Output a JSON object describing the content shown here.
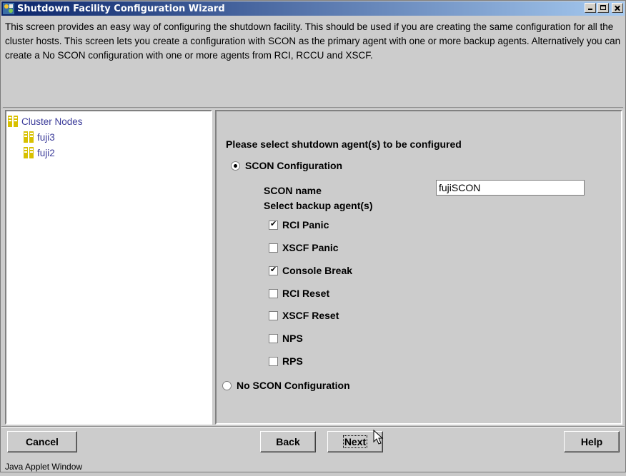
{
  "window": {
    "title": "Shutdown Facility Configuration Wizard"
  },
  "description": "This screen provides an easy way of configuring the shutdown facility. This should be used if you are creating the same configuration for all the cluster hosts. This screen lets you create a configuration with SCON as the primary agent with one or more backup agents. Alternatively you can create a No SCON configuration with one or more agents from RCI, RCCU and XSCF.",
  "tree": {
    "root_label": "Cluster Nodes",
    "nodes": [
      "fuji3",
      "fuji2"
    ]
  },
  "form": {
    "prompt": "Please select shutdown agent(s) to be configured",
    "scon_option_label": "SCON Configuration",
    "scon_option_selected": true,
    "scon_name_label": "SCON name",
    "scon_name_value": "fujiSCON",
    "backup_label": "Select backup agent(s)",
    "agents": [
      {
        "label": "RCI Panic",
        "checked": true
      },
      {
        "label": "XSCF Panic",
        "checked": false
      },
      {
        "label": "Console Break",
        "checked": true
      },
      {
        "label": "RCI Reset",
        "checked": false
      },
      {
        "label": "XSCF Reset",
        "checked": false
      },
      {
        "label": "NPS",
        "checked": false
      },
      {
        "label": "RPS",
        "checked": false
      }
    ],
    "no_scon_option_label": "No SCON Configuration",
    "no_scon_option_selected": false
  },
  "buttons": {
    "cancel": "Cancel",
    "back": "Back",
    "next": "Next",
    "help": "Help"
  },
  "status": "Java Applet Window"
}
